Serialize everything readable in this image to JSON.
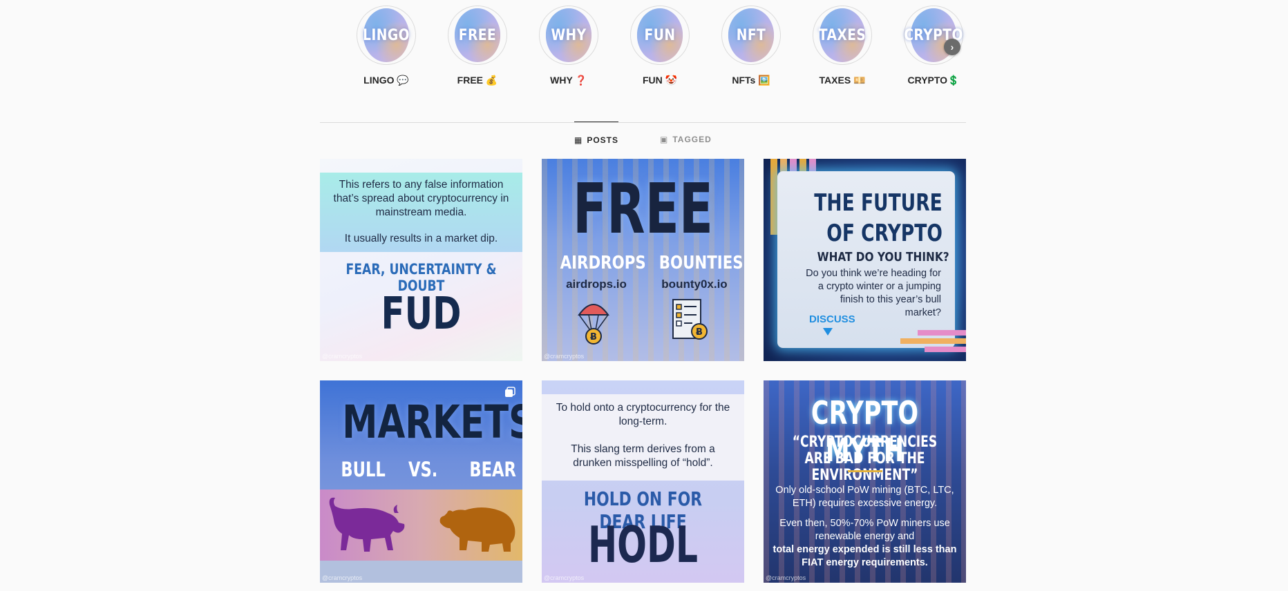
{
  "highlights": {
    "items": [
      {
        "cover": "LINGO",
        "label": "LINGO 💬"
      },
      {
        "cover": "FREE",
        "label": "FREE 💰"
      },
      {
        "cover": "WHY",
        "label": "WHY ❓"
      },
      {
        "cover": "FUN",
        "label": "FUN 🤡"
      },
      {
        "cover": "NFT",
        "label": "NFTs 🖼️"
      },
      {
        "cover": "TAXES",
        "label": "TAXES 💴"
      },
      {
        "cover": "CRYPTO",
        "label": "CRYPTO💲"
      }
    ],
    "next_icon": "chevron-right-icon"
  },
  "tabs": [
    {
      "label": "POSTS",
      "icon": "grid-icon",
      "active": true
    },
    {
      "label": "TAGGED",
      "icon": "tagged-user-icon",
      "active": false
    }
  ],
  "posts": [
    {
      "definition": "This refers to any false information that’s spread about cryptocurrency in mainstream media.",
      "note": "It usually results in a market dip.",
      "subtitle": "FEAR, UNCERTAINTY & DOUBT",
      "title": "FUD",
      "watermark": "@cramcryptos"
    },
    {
      "title": "FREE",
      "left_label": "AIRDROPS",
      "left_url": "airdrops.io",
      "right_label": "BOUNTIES",
      "right_url": "bounty0x.io",
      "left_icon": "parachute-bitcoin-icon",
      "right_icon": "checklist-bitcoin-icon",
      "watermark": "@cramcryptos"
    },
    {
      "title_line1": "THE FUTURE",
      "title_line2": "OF CRYPTO",
      "question": "WHAT DO YOU THINK?",
      "body": "Do you think we’re heading for a crypto winter or a jumping finish to this year’s bull market?",
      "cta": "DISCUSS",
      "cta_icon": "triangle-down-icon"
    },
    {
      "title": "MARKETS",
      "left": "BULL",
      "middle": "VS.",
      "right": "BEAR",
      "left_icon": "bull-icon",
      "right_icon": "bear-icon",
      "multi_icon": "carousel-icon",
      "watermark": "@cramcryptos"
    },
    {
      "definition_line1": "To hold onto a cryptocurrency for the long-term.",
      "definition_line2": "This slang term derives from a drunken misspelling of “hold”.",
      "subtitle": "HOLD ON FOR DEAR LIFE",
      "title": "HODL",
      "watermark": "@cramcryptos"
    },
    {
      "title": "CRYPTO MYTH",
      "quote": "“CRYPTOCURRENCIES ARE BAD FOR THE ENVIRONMENT”",
      "body1": "Only old-school PoW mining (BTC, LTC, ETH) requires excessive energy.",
      "body2": "Even then, 50%-70% PoW miners use renewable energy and",
      "body3": "total energy expended is still less than FIAT energy requirements.",
      "watermark": "@cramcryptos"
    }
  ],
  "colors": {
    "background": "#fafafa",
    "text": "#262626",
    "muted": "#8e8e8e",
    "divider": "#dbdbdb"
  }
}
